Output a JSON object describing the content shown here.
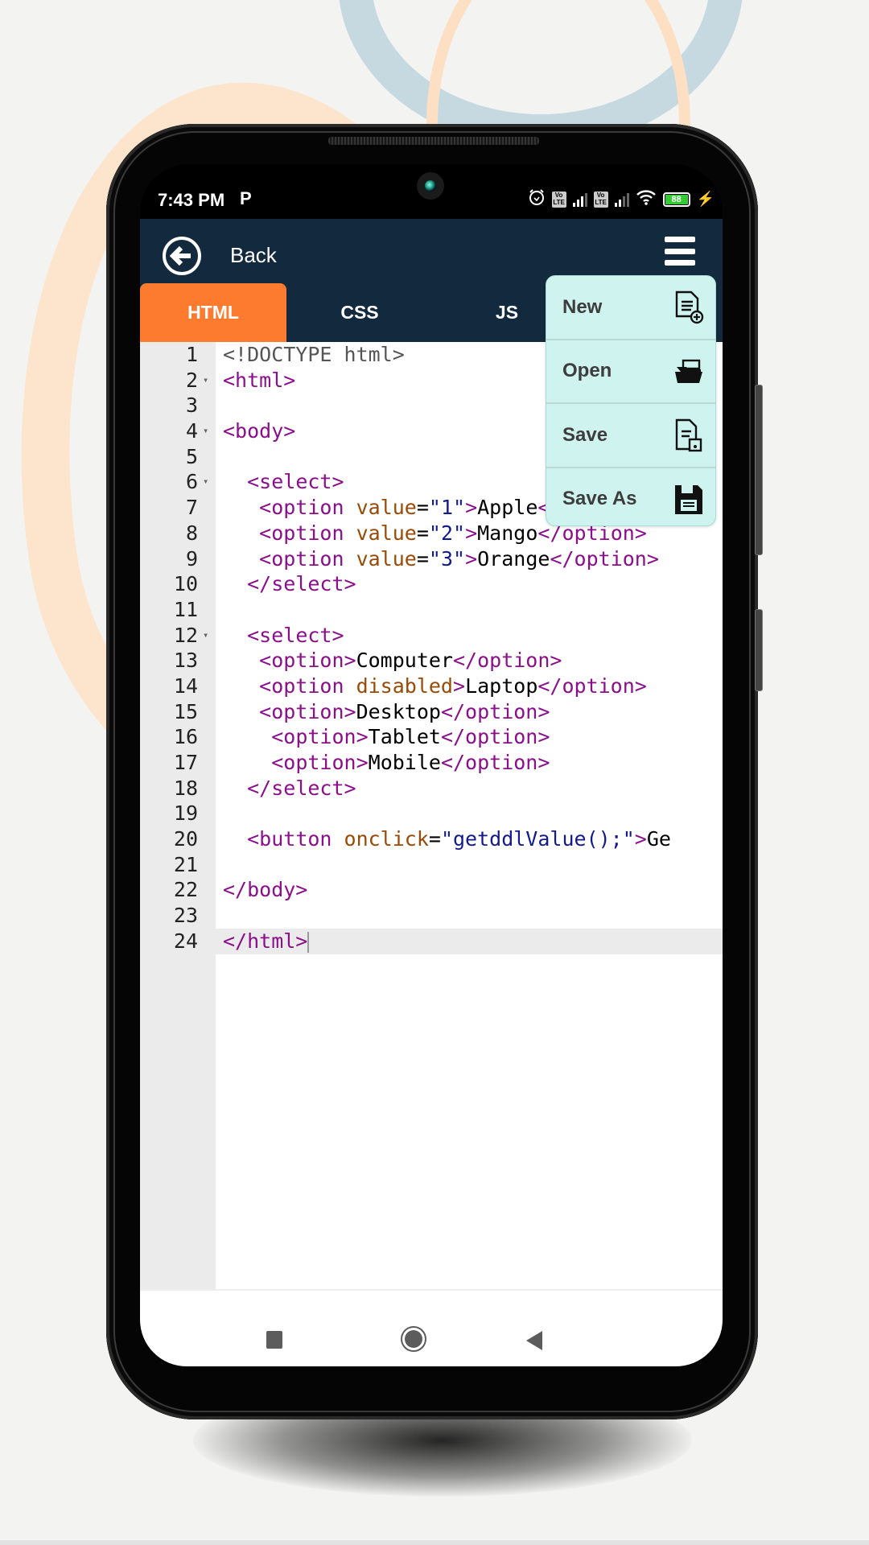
{
  "status_bar": {
    "time": "7:43 PM",
    "notification_icon": "P",
    "sim1_label": "Vo LTE",
    "sim2_label": "Vo LTE",
    "battery_level": "88",
    "icons": [
      "alarm-icon",
      "volte-icon",
      "signal-icon",
      "volte-icon",
      "signal-icon",
      "wifi-icon",
      "battery-icon",
      "charging-icon"
    ]
  },
  "app_bar": {
    "back_label": "Back",
    "back_icon": "arrow-left-circle-icon",
    "menu_icon": "hamburger-icon"
  },
  "tabs": [
    {
      "label": "HTML",
      "active": true
    },
    {
      "label": "CSS",
      "active": false
    },
    {
      "label": "JS",
      "active": false
    }
  ],
  "menu": {
    "items": [
      {
        "label": "New",
        "icon": "new-file-icon"
      },
      {
        "label": "Open",
        "icon": "open-folder-icon"
      },
      {
        "label": "Save",
        "icon": "save-file-icon"
      },
      {
        "label": "Save As",
        "icon": "floppy-disk-icon"
      }
    ]
  },
  "editor": {
    "active_line": 24,
    "lines": [
      {
        "n": "1",
        "fold": false,
        "indent": "",
        "tokens": [
          [
            "d",
            "<!DOCTYPE html>"
          ]
        ]
      },
      {
        "n": "2",
        "fold": true,
        "indent": "",
        "tokens": [
          [
            "t",
            "<html>"
          ]
        ]
      },
      {
        "n": "3",
        "fold": false,
        "indent": "",
        "tokens": []
      },
      {
        "n": "4",
        "fold": true,
        "indent": "",
        "tokens": [
          [
            "t",
            "<body>"
          ]
        ]
      },
      {
        "n": "5",
        "fold": false,
        "indent": "",
        "tokens": []
      },
      {
        "n": "6",
        "fold": true,
        "indent": "  ",
        "tokens": [
          [
            "t",
            "<select>"
          ]
        ]
      },
      {
        "n": "7",
        "fold": false,
        "indent": "   ",
        "tokens": [
          [
            "t",
            "<option "
          ],
          [
            "a",
            "value"
          ],
          [
            "x",
            "="
          ],
          [
            "s",
            "\"1\""
          ],
          [
            "t",
            ">"
          ],
          [
            "x",
            "Apple"
          ],
          [
            "t",
            "</option>"
          ]
        ]
      },
      {
        "n": "8",
        "fold": false,
        "indent": "   ",
        "tokens": [
          [
            "t",
            "<option "
          ],
          [
            "a",
            "value"
          ],
          [
            "x",
            "="
          ],
          [
            "s",
            "\"2\""
          ],
          [
            "t",
            ">"
          ],
          [
            "x",
            "Mango"
          ],
          [
            "t",
            "</option>"
          ]
        ]
      },
      {
        "n": "9",
        "fold": false,
        "indent": "   ",
        "tokens": [
          [
            "t",
            "<option "
          ],
          [
            "a",
            "value"
          ],
          [
            "x",
            "="
          ],
          [
            "s",
            "\"3\""
          ],
          [
            "t",
            ">"
          ],
          [
            "x",
            "Orange"
          ],
          [
            "t",
            "</option>"
          ]
        ]
      },
      {
        "n": "10",
        "fold": false,
        "indent": "  ",
        "tokens": [
          [
            "t",
            "</select>"
          ]
        ]
      },
      {
        "n": "11",
        "fold": false,
        "indent": "",
        "tokens": []
      },
      {
        "n": "12",
        "fold": true,
        "indent": "  ",
        "tokens": [
          [
            "t",
            "<select>"
          ]
        ]
      },
      {
        "n": "13",
        "fold": false,
        "indent": "   ",
        "tokens": [
          [
            "t",
            "<option>"
          ],
          [
            "x",
            "Computer"
          ],
          [
            "t",
            "</option>"
          ]
        ]
      },
      {
        "n": "14",
        "fold": false,
        "indent": "   ",
        "tokens": [
          [
            "t",
            "<option "
          ],
          [
            "a",
            "disabled"
          ],
          [
            "t",
            ">"
          ],
          [
            "x",
            "Laptop"
          ],
          [
            "t",
            "</option>"
          ]
        ]
      },
      {
        "n": "15",
        "fold": false,
        "indent": "   ",
        "tokens": [
          [
            "t",
            "<option>"
          ],
          [
            "x",
            "Desktop"
          ],
          [
            "t",
            "</option>"
          ]
        ]
      },
      {
        "n": "16",
        "fold": false,
        "indent": "    ",
        "tokens": [
          [
            "t",
            "<option>"
          ],
          [
            "x",
            "Tablet"
          ],
          [
            "t",
            "</option>"
          ]
        ]
      },
      {
        "n": "17",
        "fold": false,
        "indent": "    ",
        "tokens": [
          [
            "t",
            "<option>"
          ],
          [
            "x",
            "Mobile"
          ],
          [
            "t",
            "</option>"
          ]
        ]
      },
      {
        "n": "18",
        "fold": false,
        "indent": "  ",
        "tokens": [
          [
            "t",
            "</select>"
          ]
        ]
      },
      {
        "n": "19",
        "fold": false,
        "indent": "",
        "tokens": []
      },
      {
        "n": "20",
        "fold": false,
        "indent": "  ",
        "tokens": [
          [
            "t",
            "<button "
          ],
          [
            "a",
            "onclick"
          ],
          [
            "x",
            "="
          ],
          [
            "s",
            "\"getddlValue();\""
          ],
          [
            "t",
            ">"
          ],
          [
            "x",
            "Ge"
          ]
        ]
      },
      {
        "n": "21",
        "fold": false,
        "indent": "",
        "tokens": []
      },
      {
        "n": "22",
        "fold": false,
        "indent": "",
        "tokens": [
          [
            "t",
            "</body>"
          ]
        ]
      },
      {
        "n": "23",
        "fold": false,
        "indent": "",
        "tokens": []
      },
      {
        "n": "24",
        "fold": false,
        "indent": "",
        "tokens": [
          [
            "t",
            "</html>"
          ]
        ]
      }
    ]
  },
  "nav_bar": {
    "recents_icon": "square-icon",
    "home_icon": "circle-icon",
    "back_icon": "triangle-back-icon"
  },
  "colors": {
    "app_bar": "#132a3e",
    "active_tab": "#fd7b2f",
    "menu_bg": "#cff4ef",
    "tag": "#8b0e8b",
    "attribute": "#9a4a05",
    "string": "#121a8c"
  }
}
